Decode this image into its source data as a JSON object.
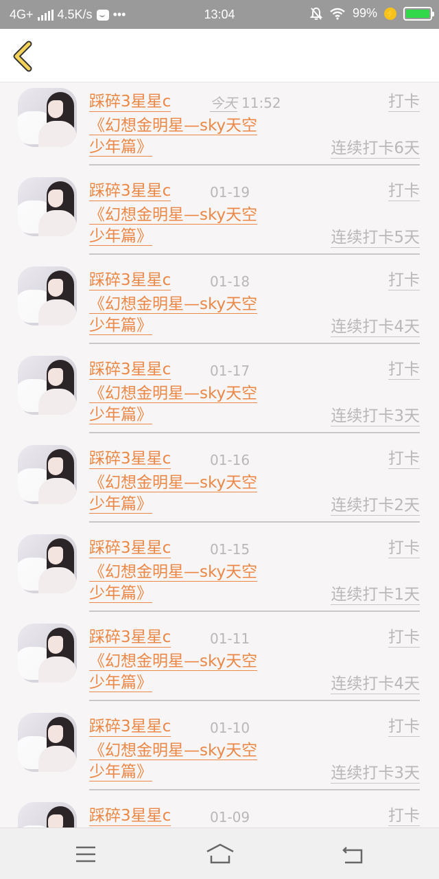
{
  "status_bar": {
    "network": "4G+",
    "speed": "4.5K/s",
    "dots": "•••",
    "time": "13:04",
    "battery": "99%",
    "battery_level": 0.99,
    "icons": [
      "signal-icon",
      "message-icon",
      "mute-bell-icon",
      "wifi-icon",
      "charging-icon",
      "battery-icon"
    ]
  },
  "header": {
    "back_icon": "chevron-left-icon"
  },
  "colors": {
    "accent": "#ec8847",
    "muted": "#b9b7b8",
    "back": "#f5d25a"
  },
  "checkins": [
    {
      "user": "踩碎3星星c",
      "date_label": "今天",
      "time": "11:52",
      "action": "打卡",
      "title_line1": "《幻想金明星—sky天空",
      "title_line2": "少年篇》",
      "streak": "连续打卡6天"
    },
    {
      "user": "踩碎3星星c",
      "date_label": "",
      "time": "01-19",
      "action": "打卡",
      "title_line1": "《幻想金明星—sky天空",
      "title_line2": "少年篇》",
      "streak": "连续打卡5天"
    },
    {
      "user": "踩碎3星星c",
      "date_label": "",
      "time": "01-18",
      "action": "打卡",
      "title_line1": "《幻想金明星—sky天空",
      "title_line2": "少年篇》",
      "streak": "连续打卡4天"
    },
    {
      "user": "踩碎3星星c",
      "date_label": "",
      "time": "01-17",
      "action": "打卡",
      "title_line1": "《幻想金明星—sky天空",
      "title_line2": "少年篇》",
      "streak": "连续打卡3天"
    },
    {
      "user": "踩碎3星星c",
      "date_label": "",
      "time": "01-16",
      "action": "打卡",
      "title_line1": "《幻想金明星—sky天空",
      "title_line2": "少年篇》",
      "streak": "连续打卡2天"
    },
    {
      "user": "踩碎3星星c",
      "date_label": "",
      "time": "01-15",
      "action": "打卡",
      "title_line1": "《幻想金明星—sky天空",
      "title_line2": "少年篇》",
      "streak": "连续打卡1天"
    },
    {
      "user": "踩碎3星星c",
      "date_label": "",
      "time": "01-11",
      "action": "打卡",
      "title_line1": "《幻想金明星—sky天空",
      "title_line2": "少年篇》",
      "streak": "连续打卡4天"
    },
    {
      "user": "踩碎3星星c",
      "date_label": "",
      "time": "01-10",
      "action": "打卡",
      "title_line1": "《幻想金明星—sky天空",
      "title_line2": "少年篇》",
      "streak": "连续打卡3天"
    },
    {
      "user": "踩碎3星星c",
      "date_label": "",
      "time": "01-09",
      "action": "打卡",
      "title_line1": "",
      "title_line2": "",
      "streak": ""
    }
  ],
  "navbar": {
    "icons": [
      "menu-icon",
      "home-icon",
      "back-icon"
    ]
  }
}
